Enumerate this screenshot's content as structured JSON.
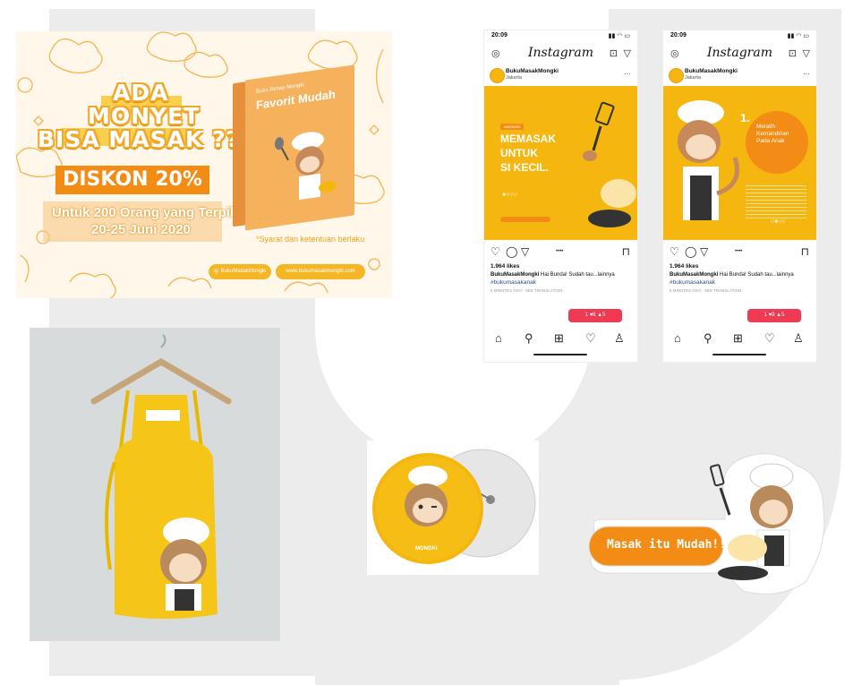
{
  "banner": {
    "headline_line1": "ADA",
    "headline_line2": "MONYET",
    "headline_line3": "BISA MASAK ??",
    "discount": "DISKON 20%",
    "offer": "Untuk 200 Orang yang Terpilih",
    "dates": "20-25 Juni 2020",
    "note": "*Syarat dan ketentuan berlaku",
    "pill_left": "ig: BukuMasakMongki",
    "pill_right": "www.bukumasakmongki.com",
    "book_title": "Favorit Mudah",
    "book_small": "Buku Resep Mongki"
  },
  "phones": [
    {
      "time": "20:09",
      "app": "Instagram",
      "user": "BukuMasakMongki",
      "location": "Jakarta",
      "post_tag": "#MONGKI",
      "post_headline1": "MEMASAK",
      "post_headline2": "UNTUK",
      "post_headline3": "SI KECIL.",
      "likes": "1.964 likes",
      "caption_user": "BukuMasakMongki",
      "caption_text": "Hai Bunda! Sudah tau...lainnya",
      "hashtag": "#bukumasakanak",
      "time_ago": "5 MINUTES AGO · SEE TRANSLATION",
      "notif": "1 ♥8 ▲5"
    },
    {
      "time": "20:09",
      "app": "Instagram",
      "user": "BukuMasakMongki",
      "location": "Jakarta",
      "post_num": "1.",
      "post_circle_text": "Melatih Kemandirian Pada Anak",
      "likes": "1.964 likes",
      "caption_user": "BukuMasakMongki",
      "caption_text": "Hai Bunda! Sudah tau...lainnya",
      "hashtag": "#bukumasakanak",
      "time_ago": "5 MINUTES AGO · SEE TRANSLATION",
      "notif": "1 ♥9 ▲5"
    }
  ],
  "badge": {
    "label": "MONGKI"
  },
  "sticker": {
    "label": "Masak itu Mudah!!"
  },
  "colors": {
    "yellow": "#f4b60f",
    "orange": "#f28c14",
    "grey_bg": "#ececed"
  }
}
